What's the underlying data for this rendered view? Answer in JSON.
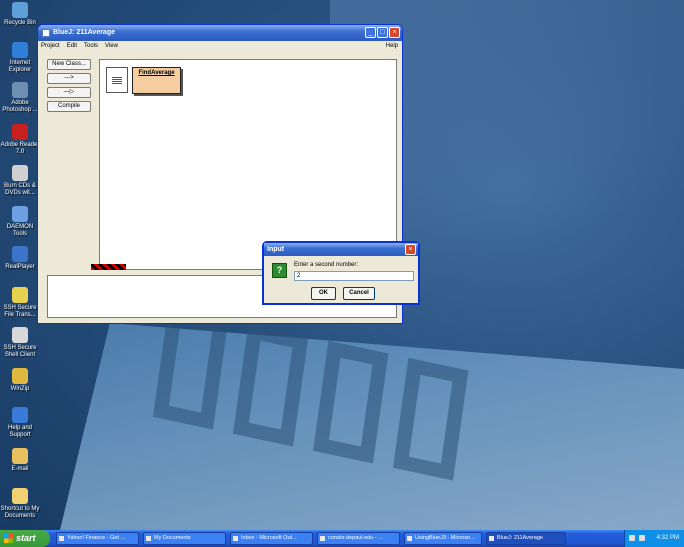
{
  "desktop": {
    "icons": [
      {
        "label": "Recycle Bin",
        "icon": "recycle-bin-icon",
        "color": "#5f9ed6"
      },
      {
        "label": "Internet Explorer",
        "icon": "internet-explorer-icon",
        "color": "#2f7fd8"
      },
      {
        "label": "Adobe Photoshop ...",
        "icon": "photoshop-icon",
        "color": "#6f8fb0"
      },
      {
        "label": "Adobe Reader 7.0",
        "icon": "adobe-reader-icon",
        "color": "#c8201e"
      },
      {
        "label": "Burn CDs & DVDs wit...",
        "icon": "cd-burner-icon",
        "color": "#d0d0d0"
      },
      {
        "label": "DAEMON Tools",
        "icon": "daemon-tools-icon",
        "color": "#6ca0e0"
      },
      {
        "label": "RealPlayer",
        "icon": "realplayer-icon",
        "color": "#3b74c8"
      },
      {
        "label": "SSH Secure File Trans...",
        "icon": "ssh-file-transfer-icon",
        "color": "#e8d050"
      },
      {
        "label": "SSH Secure Shell Client",
        "icon": "ssh-shell-icon",
        "color": "#d8d8d8"
      },
      {
        "label": "WinZip",
        "icon": "winzip-icon",
        "color": "#e0b840"
      },
      {
        "label": "Help and Support",
        "icon": "help-support-icon",
        "color": "#3a7ad8"
      },
      {
        "label": "E-mail",
        "icon": "email-icon",
        "color": "#e8c060"
      },
      {
        "label": "Shortcut to My Documents",
        "icon": "my-documents-icon",
        "color": "#f0d070"
      }
    ]
  },
  "bluej": {
    "title": "BlueJ:  211Average",
    "menu": [
      "Project",
      "Edit",
      "Tools",
      "View"
    ],
    "help_label": "Help",
    "new_class_label": "New Class...",
    "dashed_arrow": "--->",
    "solid_arrow": "—▷",
    "compile_label": "Compile",
    "class_name": "FindAverage",
    "class_color": "#f6cda0"
  },
  "dialog": {
    "title": "Input",
    "prompt": "Enter a second number:",
    "value": "2",
    "ok_label": "OK",
    "cancel_label": "Cancel"
  },
  "taskbar": {
    "start_label": "start",
    "tasks": [
      {
        "label": "Yahoo! Finance - Get ...",
        "active": false
      },
      {
        "label": "My Documents",
        "active": false
      },
      {
        "label": "Inbox - Microsoft Out...",
        "active": false
      },
      {
        "label": "condor.depaul.edu - ...",
        "active": false
      },
      {
        "label": "UsingBlueJ3 - Microso...",
        "active": false
      },
      {
        "label": "BlueJ:  211Average",
        "active": true
      }
    ],
    "clock": "4:32 PM"
  }
}
